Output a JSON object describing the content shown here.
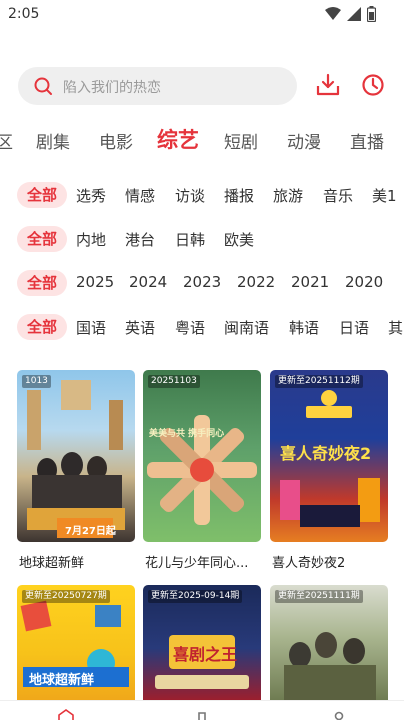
{
  "status": {
    "time": "2:05",
    "icons": [
      "wifi-icon",
      "cellular-signal-icon",
      "battery-icon"
    ]
  },
  "search": {
    "placeholder": "陷入我们的热恋",
    "icon": "search-icon"
  },
  "toolbar": {
    "download_icon": "download-icon",
    "history_icon": "history-clock-icon"
  },
  "colors": {
    "accent": "#e5343c",
    "chip_bg": "#fde3e3",
    "search_bg": "#efefef"
  },
  "tabs": [
    {
      "label": "区"
    },
    {
      "label": "剧集"
    },
    {
      "label": "电影"
    },
    {
      "label": "综艺",
      "active": true
    },
    {
      "label": "短剧"
    },
    {
      "label": "动漫"
    },
    {
      "label": "直播"
    }
  ],
  "filters": [
    {
      "selected": "全部",
      "options": [
        "选秀",
        "情感",
        "访谈",
        "播报",
        "旅游",
        "音乐",
        "美1"
      ]
    },
    {
      "selected": "全部",
      "options": [
        "内地",
        "港台",
        "日韩",
        "欧美"
      ]
    },
    {
      "selected": "全部",
      "options": [
        "2025",
        "2024",
        "2023",
        "2022",
        "2021",
        "2020"
      ]
    },
    {
      "selected": "全部",
      "options": [
        "国语",
        "英语",
        "粤语",
        "闽南语",
        "韩语",
        "日语",
        "其"
      ]
    }
  ],
  "cards": [
    {
      "badge": "1013",
      "title": "地球超新鲜",
      "poster_text": "7月27日起"
    },
    {
      "badge": "20251103",
      "title": "花儿与少年同心...",
      "poster_text": "美美与共 携手同心"
    },
    {
      "badge": "更新至20251112期",
      "title": "喜人奇妙夜2",
      "poster_text": "喜人奇妙夜2"
    },
    {
      "badge": "更新至20250727期",
      "title": "",
      "poster_text": "地球超新鲜"
    },
    {
      "badge": "更新至2025-09-14期",
      "title": "",
      "poster_text": "喜剧之王"
    },
    {
      "badge": "更新至20251111期",
      "title": "",
      "poster_text": ""
    }
  ],
  "bottom_nav": [
    "home-icon",
    "library-icon",
    "profile-icon"
  ]
}
